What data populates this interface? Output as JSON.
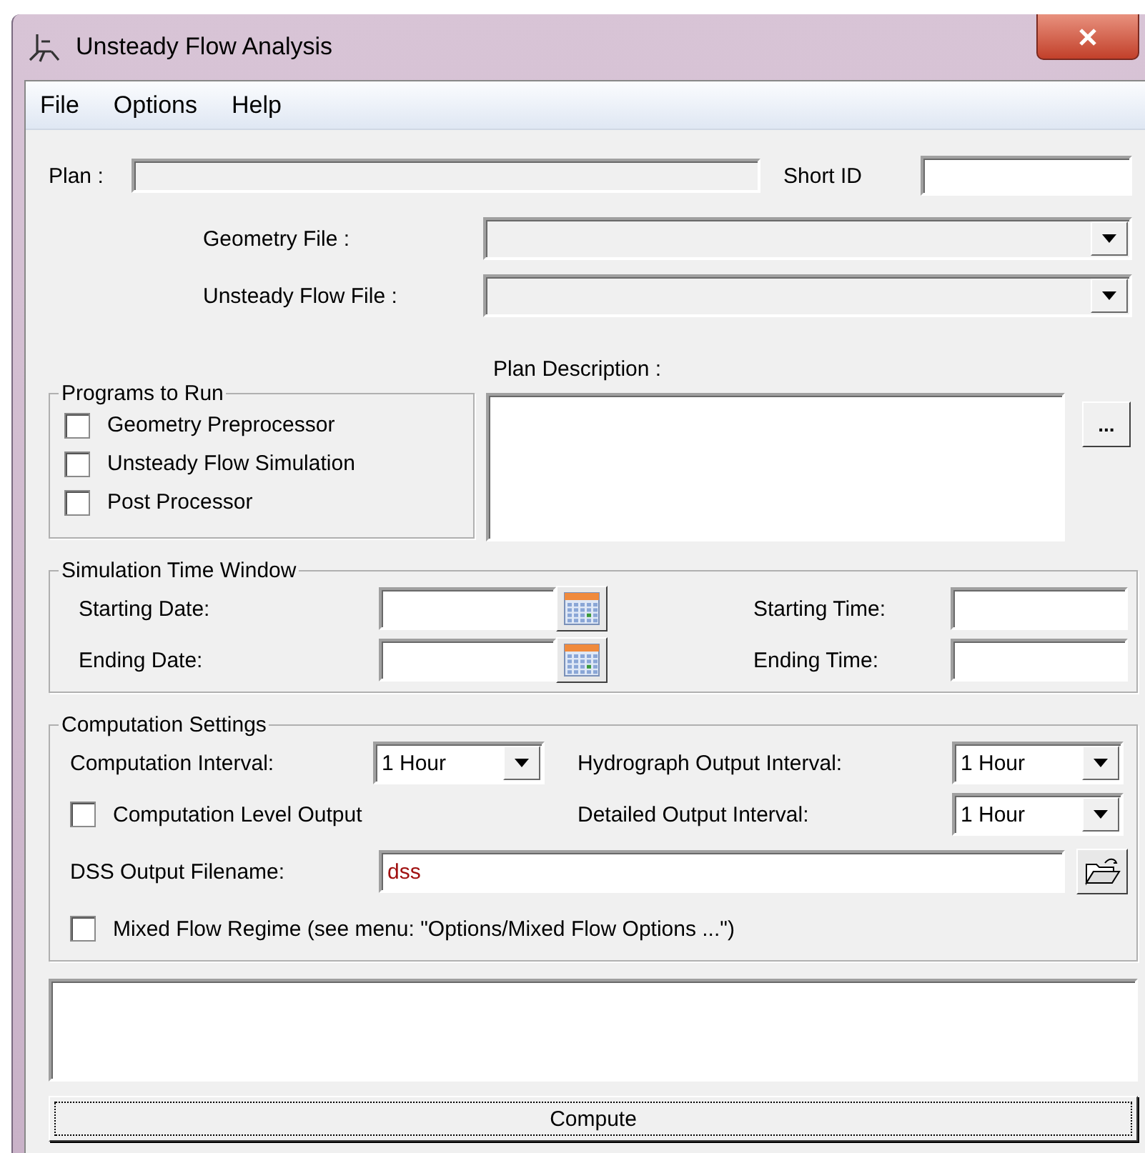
{
  "window": {
    "title": "Unsteady Flow Analysis"
  },
  "menu": [
    "File",
    "Options",
    "Help"
  ],
  "plan": {
    "label": "Plan :",
    "short_id_label": "Short ID"
  },
  "files": [
    {
      "label": "Geometry File :"
    },
    {
      "label": "Unsteady Flow File :"
    }
  ],
  "plan_description": {
    "label": "Plan Description :",
    "button": "..."
  },
  "programs": {
    "title": "Programs to Run",
    "items": [
      {
        "label": "Geometry Preprocessor",
        "checked": false
      },
      {
        "label": "Unsteady Flow Simulation",
        "checked": false
      },
      {
        "label": "Post Processor",
        "checked": false
      }
    ]
  },
  "time_window": {
    "title": "Simulation Time Window",
    "rows": [
      {
        "date_label": "Starting Date:",
        "time_label": "Starting Time:"
      },
      {
        "date_label": "Ending Date:",
        "time_label": "Ending Time:"
      }
    ]
  },
  "computation": {
    "title": "Computation Settings",
    "interval_label": "Computation Interval:",
    "interval": "1 Hour",
    "hydrograph_label": "Hydrograph Output Interval:",
    "hydrograph": "1 Hour",
    "level_output": {
      "label": "Computation Level Output",
      "checked": false
    },
    "detailed_label": "Detailed Output Interval:",
    "detailed": "1 Hour",
    "dss_label": "DSS Output Filename:",
    "dss_value": "dss",
    "mixed_flow": {
      "label": "Mixed Flow Regime (see menu: \"Options/Mixed Flow Options ...\")",
      "checked": false
    }
  },
  "compute_button": "Compute"
}
